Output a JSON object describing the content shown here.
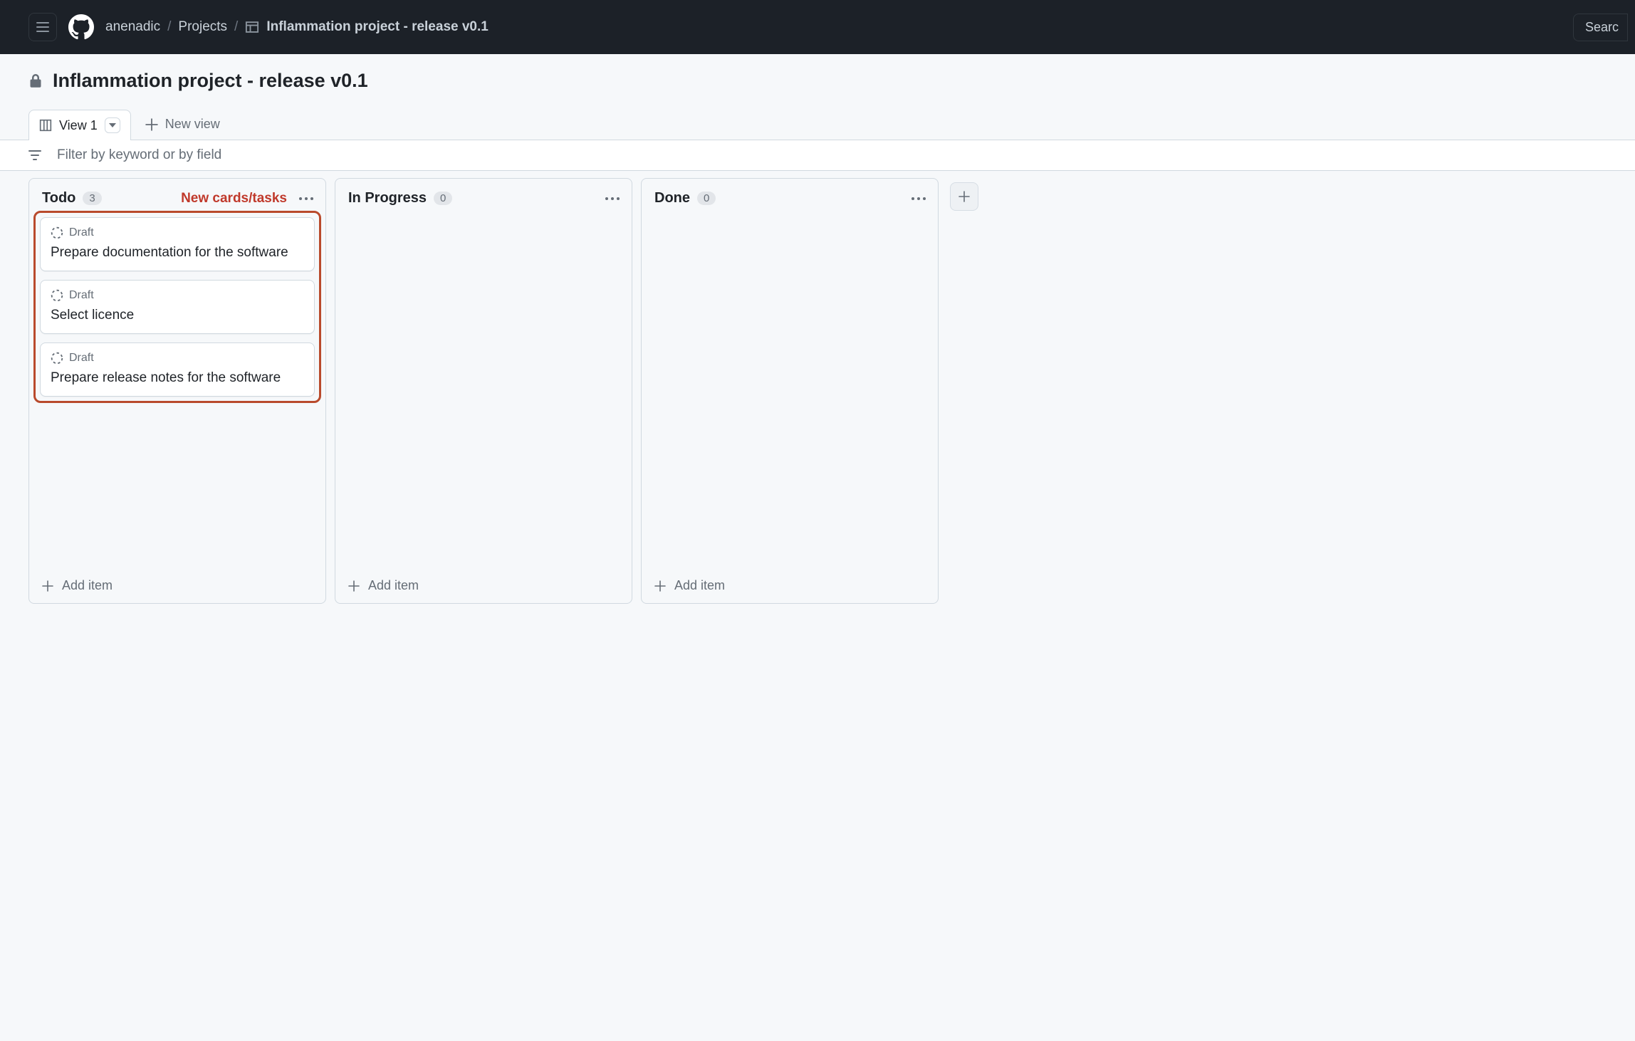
{
  "header": {
    "breadcrumb": [
      "anenadic",
      "Projects",
      "Inflammation project - release v0.1"
    ],
    "search_label": "Searc"
  },
  "subheader": {
    "title": "Inflammation project - release v0.1",
    "active_tab": "View 1",
    "new_view_label": "New view"
  },
  "filter": {
    "placeholder": "Filter by keyword or by field",
    "value": ""
  },
  "annotation": "New cards/tasks",
  "columns": [
    {
      "name": "Todo",
      "count": "3",
      "highlighted": true,
      "cards": [
        {
          "status": "Draft",
          "title": "Prepare documentation for the software"
        },
        {
          "status": "Draft",
          "title": "Select licence"
        },
        {
          "status": "Draft",
          "title": "Prepare release notes for the software"
        }
      ],
      "add_label": "Add item"
    },
    {
      "name": "In Progress",
      "count": "0",
      "highlighted": false,
      "cards": [],
      "add_label": "Add item"
    },
    {
      "name": "Done",
      "count": "0",
      "highlighted": false,
      "cards": [],
      "add_label": "Add item"
    }
  ]
}
